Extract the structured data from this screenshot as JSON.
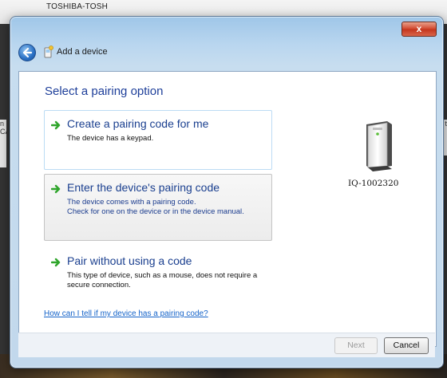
{
  "background": {
    "top_text": "TOSHIBA-TOSH",
    "left_strip_text": "n\nCA",
    "right_strip_text": "t"
  },
  "window": {
    "title": "Add a device",
    "close_label": "x",
    "heading": "Select a pairing option",
    "options": [
      {
        "title": "Create a pairing code for me",
        "description": "The device has a keypad."
      },
      {
        "title": "Enter the device's pairing code",
        "description": "The device comes with a pairing code.\nCheck for one on the device or in the device manual."
      },
      {
        "title": "Pair without using a code",
        "description": "This type of device, such as a mouse, does not require a secure connection."
      }
    ],
    "device": {
      "name": "IQ-1002320",
      "icon": "computer-tower-icon"
    },
    "help_link": "How can I tell if my device has a pairing code?",
    "buttons": {
      "next": "Next",
      "cancel": "Cancel"
    }
  },
  "colors": {
    "heading": "#1e3f9a",
    "link": "#1463c9",
    "arrow_green": "#2fa52b",
    "close_red": "#c3341c"
  }
}
